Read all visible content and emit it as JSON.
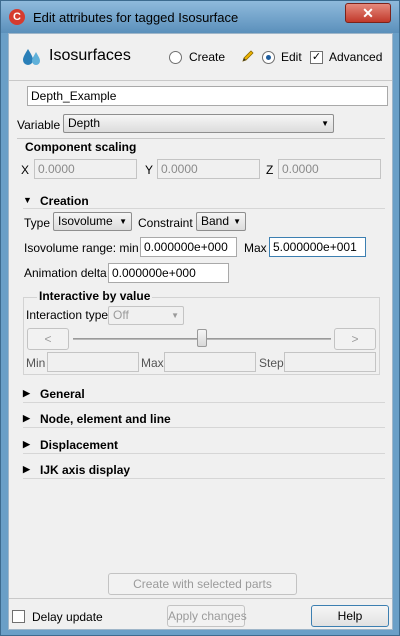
{
  "window": {
    "title": "Edit attributes for tagged Isosurface",
    "app_icon": "ensight-icon",
    "close_glyph": "✕"
  },
  "header": {
    "title": "Isosurfaces",
    "logo_icon": "water-drops-icon",
    "mode_create": "Create",
    "mode_edit": "Edit",
    "mode_selected": "Edit",
    "advanced_label": "Advanced",
    "advanced_checked": true
  },
  "name_field": {
    "value": "Depth_Example"
  },
  "variable": {
    "label": "Variable",
    "selected": "Depth"
  },
  "component_scaling": {
    "title": "Component scaling",
    "x_label": "X",
    "x_value": "0.0000",
    "y_label": "Y",
    "y_value": "0.0000",
    "z_label": "Z",
    "z_value": "0.0000"
  },
  "creation": {
    "title": "Creation",
    "expanded": true,
    "type_label": "Type",
    "type_value": "Isovolume",
    "constraint_label": "Constraint",
    "constraint_value": "Band",
    "range_label": "Isovolume range: min",
    "range_min": "0.000000e+000",
    "max_label": "Max",
    "range_max": "5.000000e+001",
    "anim_label": "Animation delta",
    "anim_value": "0.000000e+000",
    "interactive": {
      "title": "Interactive by value",
      "type_label": "Interaction type",
      "type_value": "Off",
      "prev": "<",
      "next": ">",
      "min_label": "Min",
      "max_label": "Max",
      "step_label": "Step"
    }
  },
  "sections": [
    {
      "label": "General"
    },
    {
      "label": "Node, element and line"
    },
    {
      "label": "Displacement"
    },
    {
      "label": "IJK axis display"
    }
  ],
  "footer": {
    "create_button": "Create with selected parts",
    "delay_update": "Delay update",
    "delay_checked": false,
    "apply_button": "Apply changes",
    "help_button": "Help"
  },
  "colors": {
    "title_bar": "#6a9fc7",
    "close_button": "#c1392b",
    "panel": "#f0f0f0",
    "focus": "#3c7fb1"
  }
}
